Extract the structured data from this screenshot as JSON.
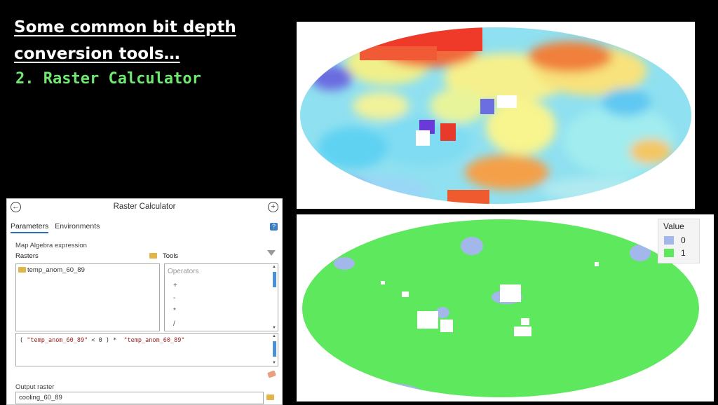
{
  "slide": {
    "title_line1": "Some common bit depth",
    "title_line2": "conversion tools…",
    "subtitle": "2. Raster Calculator"
  },
  "legend": {
    "title": "Value",
    "items": [
      {
        "label": "0",
        "color": "#a3b8ea"
      },
      {
        "label": "1",
        "color": "#5ee85e"
      }
    ]
  },
  "calculator": {
    "title": "Raster Calculator",
    "tabs": [
      "Parameters",
      "Environments"
    ],
    "section_label": "Map Algebra expression",
    "rasters_label": "Rasters",
    "tools_label": "Tools",
    "raster_items": [
      "temp_anom_60_89"
    ],
    "operators_header": "Operators",
    "operators": [
      "+",
      "-",
      "*",
      "/"
    ],
    "expression_prefix": "( ",
    "expression_string1": "\"temp_anom_60_89\"",
    "expression_middle": " < 0 ) *  ",
    "expression_string2": "\"temp_anom_60_89\"",
    "output_label": "Output raster",
    "output_value": "cooling_60_89"
  }
}
